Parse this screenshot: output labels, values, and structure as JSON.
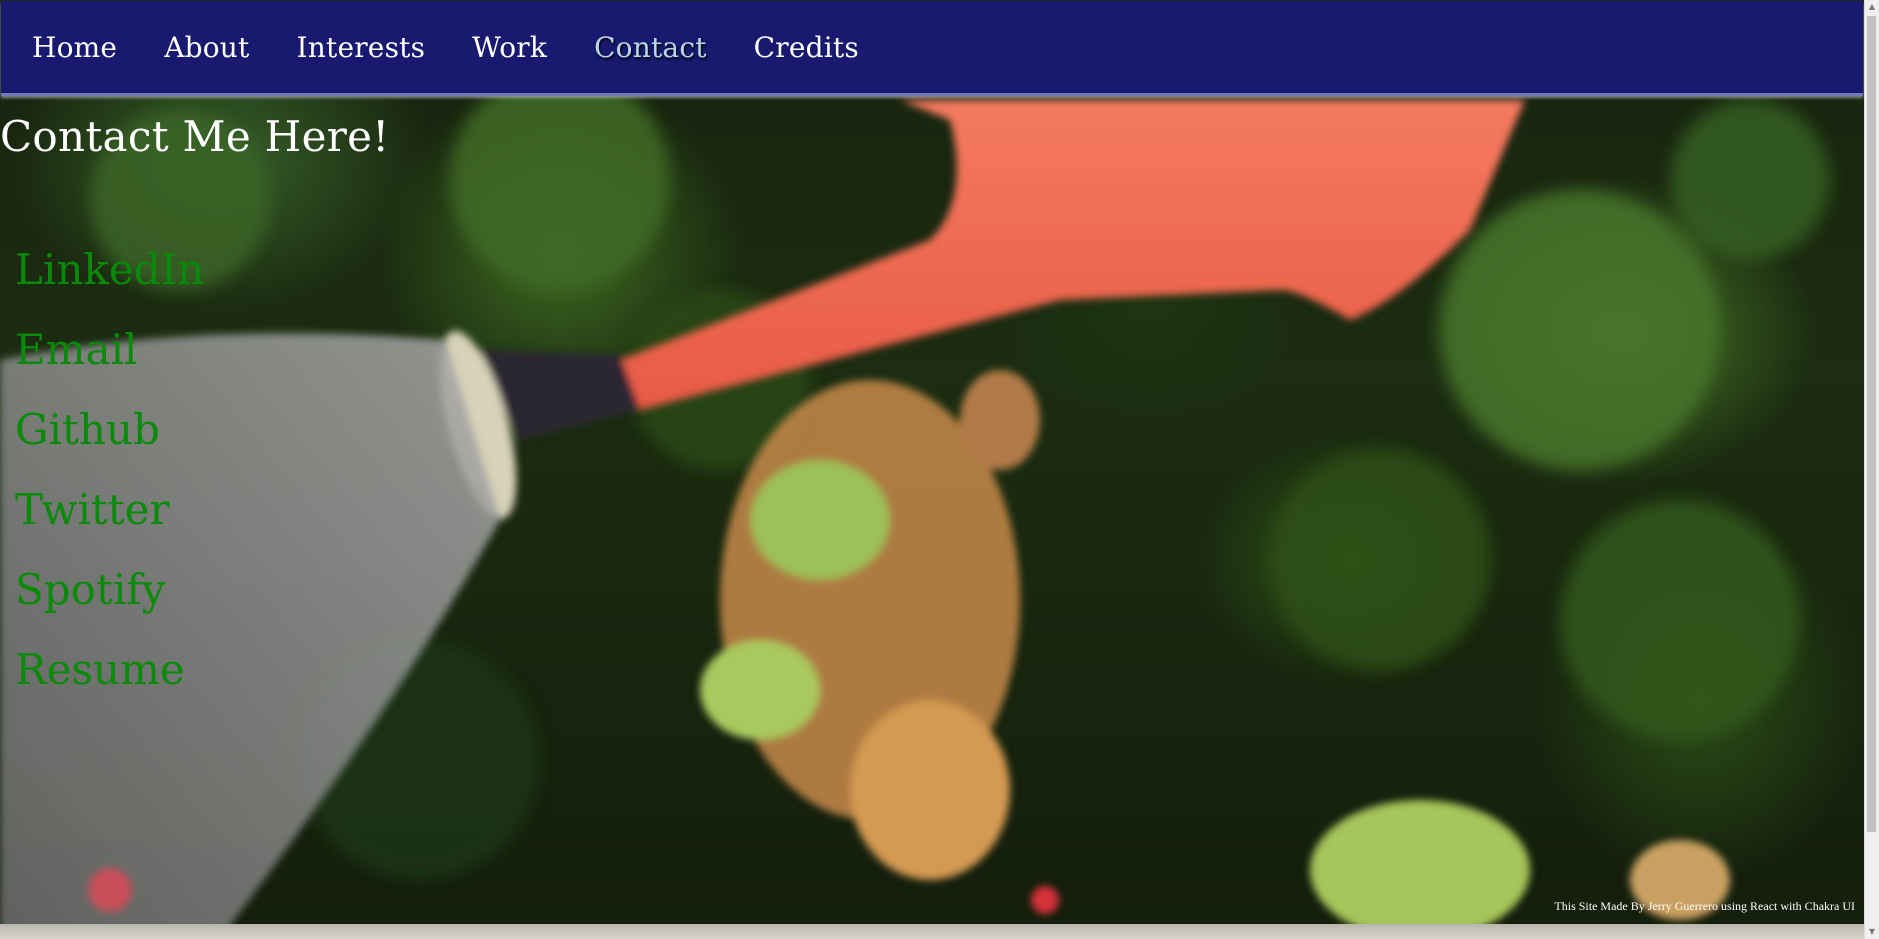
{
  "nav": {
    "items": [
      {
        "label": "Home",
        "active": false
      },
      {
        "label": "About",
        "active": false
      },
      {
        "label": "Interests",
        "active": false
      },
      {
        "label": "Work",
        "active": false
      },
      {
        "label": "Contact",
        "active": true
      },
      {
        "label": "Credits",
        "active": false
      }
    ]
  },
  "main": {
    "title": "Contact Me Here!",
    "links": [
      {
        "label": "LinkedIn"
      },
      {
        "label": "Email"
      },
      {
        "label": "Github"
      },
      {
        "label": "Twitter"
      },
      {
        "label": "Spotify"
      },
      {
        "label": "Resume"
      }
    ]
  },
  "footer": {
    "credit": "This Site Made By Jerry Guerrero using React with Chakra UI"
  },
  "background": {
    "subject": "watering can spout pouring water onto potted geranium plants in front of green foliage"
  },
  "colors": {
    "navbar": "#191970",
    "link": "#0a8a0a",
    "active_nav": "#b8d8e8",
    "title": "#ffffff"
  }
}
